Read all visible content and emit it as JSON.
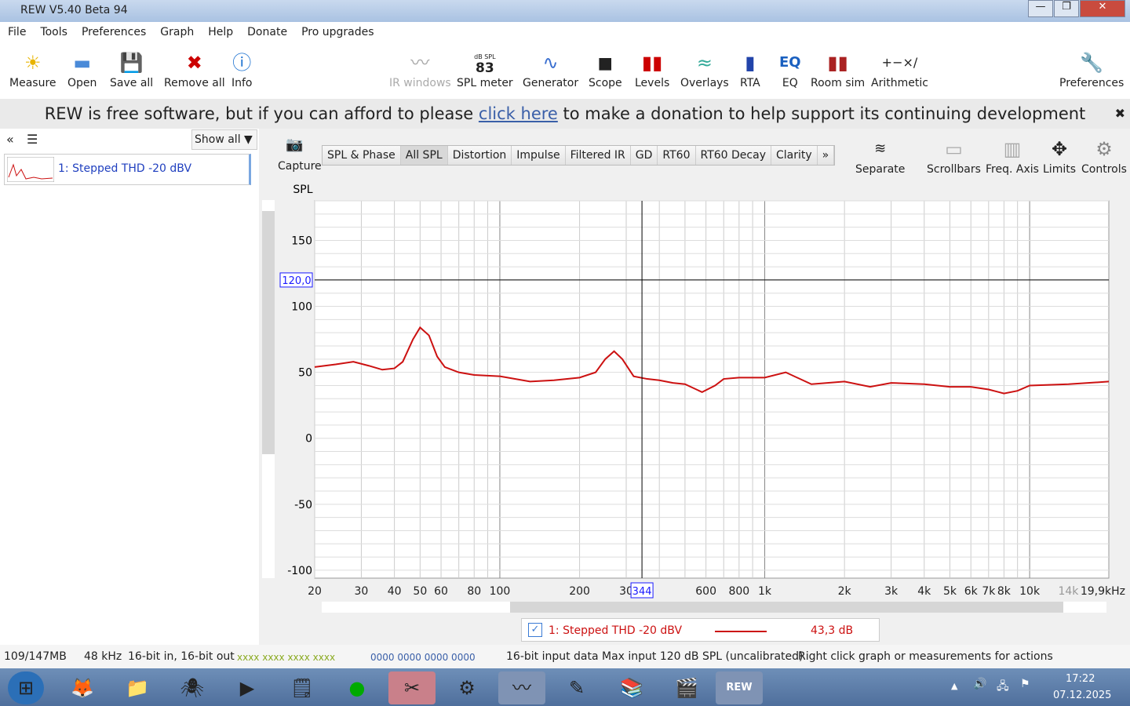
{
  "window": {
    "title": "REW V5.40 Beta 94",
    "min": "—",
    "max": "❐",
    "close": "✕"
  },
  "menu": [
    "File",
    "Tools",
    "Preferences",
    "Graph",
    "Help",
    "Donate",
    "Pro upgrades"
  ],
  "toolbar": {
    "left": [
      {
        "label": "Measure",
        "icon": "measure-icon"
      },
      {
        "label": "Open",
        "icon": "folder-icon"
      },
      {
        "label": "Save all",
        "icon": "save-icon"
      },
      {
        "label": "Remove all",
        "icon": "remove-icon"
      },
      {
        "label": "Info",
        "icon": "info-icon"
      }
    ],
    "center": [
      {
        "label": "IR windows",
        "icon": "ir-windows-icon",
        "disabled": true
      },
      {
        "label": "SPL meter",
        "icon": "spl-meter-icon",
        "meter_unit": "dB SPL",
        "meter_value": "83"
      },
      {
        "label": "Generator",
        "icon": "generator-icon"
      },
      {
        "label": "Scope",
        "icon": "scope-icon"
      },
      {
        "label": "Levels",
        "icon": "levels-icon"
      },
      {
        "label": "Overlays",
        "icon": "overlays-icon"
      },
      {
        "label": "RTA",
        "icon": "rta-icon"
      },
      {
        "label": "EQ",
        "icon": "eq-icon"
      },
      {
        "label": "Room sim",
        "icon": "room-sim-icon"
      },
      {
        "label": "Arithmetic",
        "icon": "arithmetic-icon"
      }
    ],
    "right": {
      "label": "Preferences",
      "icon": "wrench-icon"
    }
  },
  "banner": {
    "before": "REW is free software, but if you can afford to please ",
    "link": "click here",
    "after": " to make a donation to help support its continuing development",
    "close": "✖"
  },
  "measurements": {
    "show_all": "Show all",
    "items": [
      {
        "label": "1: Stepped THD  -20 dBV"
      }
    ]
  },
  "graph": {
    "capture": "Capture",
    "tabs": [
      "SPL & Phase",
      "All SPL",
      "Distortion",
      "Impulse",
      "Filtered IR",
      "GD",
      "RT60",
      "RT60 Decay",
      "Clarity",
      "»"
    ],
    "selected_tab": "All SPL",
    "tools": [
      "Separate",
      "Scrollbars",
      "Freq. Axis",
      "Limits",
      "Controls"
    ],
    "legend": {
      "label": "1: Stepped THD  -20 dBV",
      "value": "43,3 dB",
      "checked": true
    }
  },
  "chart_data": {
    "type": "line",
    "ylabel": "SPL",
    "xscale": "log",
    "xlim": [
      20,
      19900
    ],
    "ylim": [
      -106,
      180
    ],
    "grid": true,
    "yticks": [
      150,
      100,
      50,
      0,
      -50,
      -100
    ],
    "xticks": [
      {
        "v": 20,
        "l": "20"
      },
      {
        "v": 30,
        "l": "30"
      },
      {
        "v": 40,
        "l": "40"
      },
      {
        "v": 50,
        "l": "50"
      },
      {
        "v": 60,
        "l": "60"
      },
      {
        "v": 80,
        "l": "80"
      },
      {
        "v": 100,
        "l": "100"
      },
      {
        "v": 200,
        "l": "200"
      },
      {
        "v": 300,
        "l": "30"
      },
      {
        "v": 600,
        "l": "600"
      },
      {
        "v": 800,
        "l": "800"
      },
      {
        "v": 1000,
        "l": "1k"
      },
      {
        "v": 2000,
        "l": "2k"
      },
      {
        "v": 3000,
        "l": "3k"
      },
      {
        "v": 4000,
        "l": "4k"
      },
      {
        "v": 5000,
        "l": "5k"
      },
      {
        "v": 6000,
        "l": "6k"
      },
      {
        "v": 7000,
        "l": "7k"
      },
      {
        "v": 8000,
        "l": "8k"
      },
      {
        "v": 10000,
        "l": "10k"
      },
      {
        "v": 14000,
        "l": "14k"
      },
      {
        "v": 19900,
        "l": "19,9kHz"
      }
    ],
    "cursor": {
      "x": 344,
      "x_label": "344",
      "y": 120,
      "y_label": "120,0"
    },
    "series": [
      {
        "name": "1: Stepped THD  -20 dBV",
        "color": "#cc1111",
        "x": [
          20,
          24,
          28,
          32,
          36,
          40,
          43,
          47,
          50,
          54,
          58,
          62,
          70,
          80,
          100,
          130,
          160,
          200,
          230,
          250,
          270,
          290,
          320,
          360,
          400,
          450,
          500,
          580,
          650,
          700,
          800,
          1000,
          1200,
          1500,
          2000,
          2500,
          3000,
          4000,
          5000,
          6000,
          7000,
          8000,
          9000,
          10000,
          14000,
          19900
        ],
        "y": [
          54,
          56,
          58,
          55,
          52,
          53,
          58,
          75,
          84,
          78,
          62,
          54,
          50,
          48,
          47,
          43,
          44,
          46,
          50,
          60,
          66,
          60,
          47,
          45,
          44,
          42,
          41,
          35,
          40,
          45,
          46,
          46,
          50,
          41,
          43,
          39,
          42,
          41,
          39,
          39,
          37,
          34,
          36,
          40,
          41,
          43
        ]
      }
    ]
  },
  "status": {
    "memory": "109/147MB",
    "rate": "48 kHz",
    "bits": "16-bit in, 16-bit out",
    "in_levels": "xxxx xxxx  xxxx xxxx",
    "out_levels": "0000 0000  0000 0000",
    "input_data": "16-bit input data",
    "max_input": "Max input 120 dB SPL (uncalibrated)",
    "hint": "Right click graph or measurements for actions"
  },
  "taskbar": {
    "time": "17:22",
    "date": "07.12.2025"
  },
  "colors": {
    "curve": "#cc1111",
    "banner_link": "#3a5fa8",
    "cursor_label": "#1a1aff"
  }
}
